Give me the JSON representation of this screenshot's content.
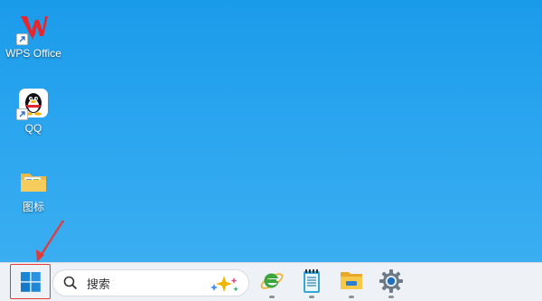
{
  "desktop": {
    "icons": [
      {
        "label": "WPS Office",
        "icon": "wps-office-icon"
      },
      {
        "label": "QQ",
        "icon": "qq-penguin-icon"
      },
      {
        "label": "图标",
        "icon": "folder-icon"
      }
    ]
  },
  "taskbar": {
    "start_icon": "windows-logo-icon",
    "search": {
      "placeholder": "搜索",
      "icon": "search-icon",
      "copilot_icon": "sparkle-icon"
    },
    "apps": [
      {
        "name": "Internet Explorer",
        "icon": "ie-icon"
      },
      {
        "name": "Notepad",
        "icon": "notepad-icon"
      },
      {
        "name": "File Explorer",
        "icon": "file-explorer-icon"
      },
      {
        "name": "Settings",
        "icon": "settings-gear-icon"
      }
    ]
  },
  "annotation": {
    "color": "#e53935",
    "target": "start-button"
  }
}
